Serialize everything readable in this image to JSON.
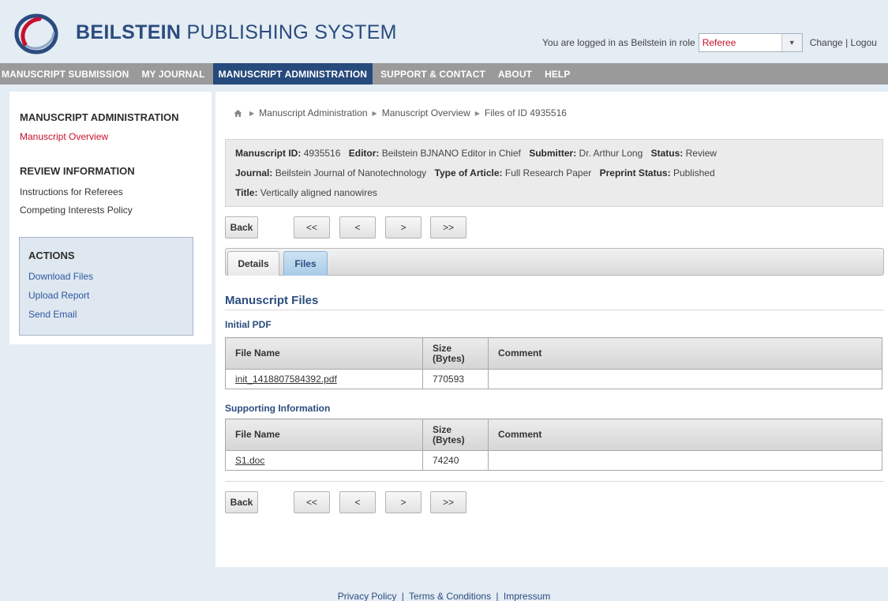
{
  "header": {
    "brand_bold": "BEILSTEIN",
    "brand_rest": "PUBLISHING SYSTEM",
    "login_text": "You are logged in as Beilstein in role",
    "role_value": "Referee",
    "change_label": "Change",
    "logout_label": "Logou",
    "link_separator": "|"
  },
  "nav": {
    "items": [
      {
        "label": "MANUSCRIPT SUBMISSION"
      },
      {
        "label": "MY JOURNAL"
      },
      {
        "label": "MANUSCRIPT ADMINISTRATION"
      },
      {
        "label": "SUPPORT & CONTACT"
      },
      {
        "label": "ABOUT"
      },
      {
        "label": "HELP"
      }
    ],
    "active_index": 2
  },
  "sidebar": {
    "admin_heading": "MANUSCRIPT ADMINISTRATION",
    "admin_links": [
      "Manuscript Overview"
    ],
    "review_heading": "REVIEW INFORMATION",
    "review_links": [
      "Instructions for Referees",
      "Competing Interests Policy"
    ],
    "actions_heading": "ACTIONS",
    "action_links": [
      "Download Files",
      "Upload Report",
      "Send Email"
    ]
  },
  "breadcrumb": [
    "Manuscript Administration",
    "Manuscript Overview",
    "Files of ID 4935516"
  ],
  "manuscript": {
    "id_label": "Manuscript ID:",
    "id": "4935516",
    "editor_label": "Editor:",
    "editor": "Beilstein BJNANO Editor in Chief",
    "submitter_label": "Submitter:",
    "submitter": "Dr. Arthur Long",
    "status_label": "Status:",
    "status": "Review",
    "journal_label": "Journal:",
    "journal": "Beilstein Journal of Nanotechnology",
    "type_label": "Type of Article:",
    "type": "Full Research Paper",
    "preprint_label": "Preprint Status:",
    "preprint": "Published",
    "title_label": "Title:",
    "title": "Vertically aligned nanowires"
  },
  "pager": {
    "back": "Back",
    "first": "<<",
    "prev": "<",
    "next": ">",
    "last": ">>"
  },
  "tabs": [
    {
      "label": "Details"
    },
    {
      "label": "Files"
    }
  ],
  "active_tab": "Files",
  "files_section": {
    "title": "Manuscript Files",
    "columns": {
      "name": "File Name",
      "size_line1": "Size",
      "size_line2": "(Bytes)",
      "comment": "Comment"
    },
    "groups": [
      {
        "title": "Initial PDF",
        "rows": [
          {
            "name": "init_1418807584392.pdf",
            "size": "770593",
            "comment": ""
          }
        ]
      },
      {
        "title": "Supporting Information",
        "rows": [
          {
            "name": "S1.doc",
            "size": "74240",
            "comment": ""
          }
        ]
      }
    ]
  },
  "footer": {
    "links": [
      "Privacy Policy",
      "Terms & Conditions",
      "Impressum"
    ],
    "separator": "|"
  },
  "colors": {
    "brand": "#2b4c7e",
    "accent_red": "#c8102e",
    "nav_bg": "#9a9a9a",
    "nav_active": "#274a7c",
    "link": "#2b5aa0"
  },
  "icons": [
    "home-icon",
    "breadcrumb-arrow-icon",
    "dropdown-arrow-icon",
    "logo-icon"
  ]
}
